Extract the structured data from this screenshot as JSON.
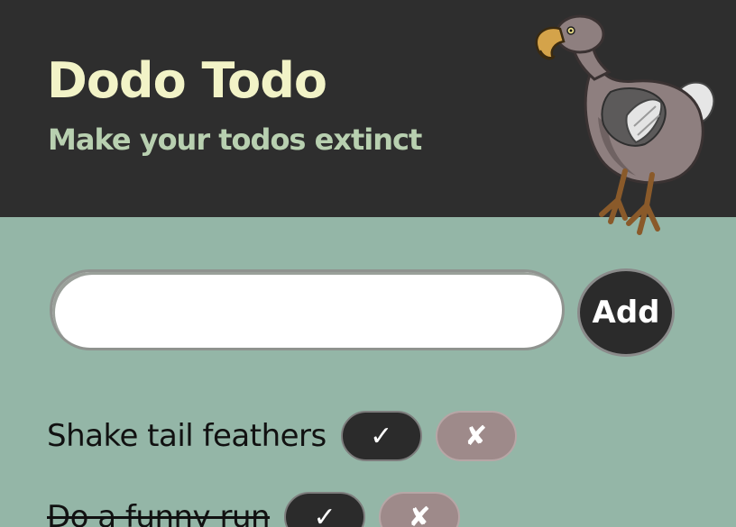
{
  "header": {
    "title": "Dodo Todo",
    "subtitle": "Make your todos extinct",
    "mascot_icon": "dodo-bird-illustration"
  },
  "new_todo": {
    "value": "",
    "placeholder": "",
    "add_label": "Add"
  },
  "todos": [
    {
      "text": "Shake tail feathers",
      "done": false,
      "complete_symbol": "✓",
      "delete_symbol": "✘"
    },
    {
      "text": "Do a funny run",
      "done": true,
      "complete_symbol": "✓",
      "delete_symbol": "✘"
    }
  ],
  "colors": {
    "header_bg": "#2e2e2e",
    "page_bg": "#94b6a7",
    "title": "#f2f3c7",
    "subtitle": "#b8d0b0",
    "complete_button": "#2b2b2b",
    "delete_button": "#9e8a8a"
  }
}
